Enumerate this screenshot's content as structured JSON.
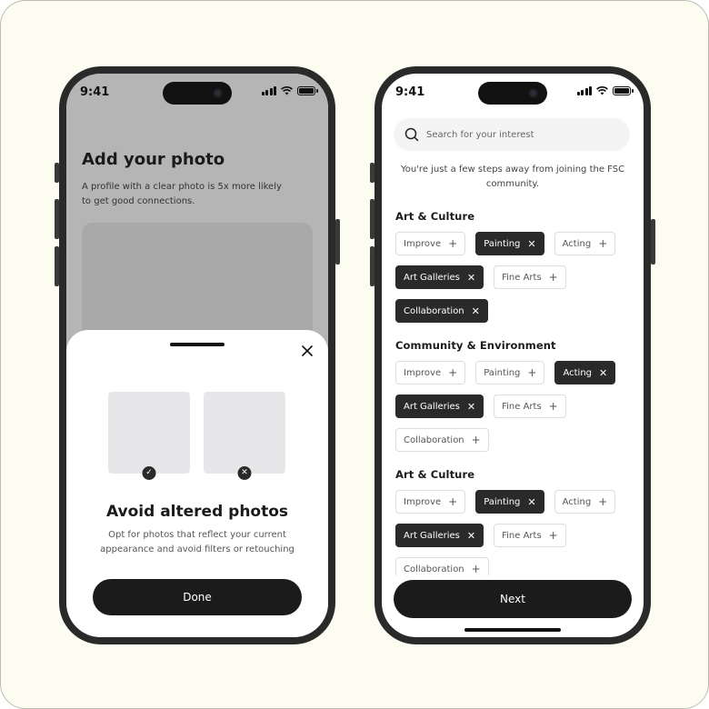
{
  "left_phone": {
    "status_time": "9:41",
    "title": "Add your photo",
    "subtitle": "A profile with a clear photo is 5x more likely to get good connections.",
    "sheet": {
      "close_icon": "close-icon",
      "good_badge_icon": "check-icon",
      "bad_badge_icon": "x-icon",
      "title": "Avoid altered photos",
      "description": "Opt for photos that reflect your current appearance and avoid filters or retouching",
      "done_label": "Done"
    }
  },
  "right_phone": {
    "status_time": "9:41",
    "search": {
      "placeholder": "Search for your interest",
      "value": ""
    },
    "intro": "You're just a few steps away from joining the FSC community.",
    "sections": [
      {
        "title": "Art & Culture",
        "chips": [
          {
            "label": "Improve",
            "selected": false
          },
          {
            "label": "Painting",
            "selected": true
          },
          {
            "label": "Acting",
            "selected": false
          },
          {
            "label": "Art Galleries",
            "selected": true
          },
          {
            "label": "Fine Arts",
            "selected": false
          },
          {
            "label": "Collaboration",
            "selected": true
          }
        ]
      },
      {
        "title": "Community & Environment",
        "chips": [
          {
            "label": "Improve",
            "selected": false
          },
          {
            "label": "Painting",
            "selected": false
          },
          {
            "label": "Acting",
            "selected": true
          },
          {
            "label": "Art Galleries",
            "selected": true
          },
          {
            "label": "Fine Arts",
            "selected": false
          },
          {
            "label": "Collaboration",
            "selected": false
          }
        ]
      },
      {
        "title": "Art & Culture",
        "chips": [
          {
            "label": "Improve",
            "selected": false
          },
          {
            "label": "Painting",
            "selected": true
          },
          {
            "label": "Acting",
            "selected": false
          },
          {
            "label": "Art Galleries",
            "selected": true
          },
          {
            "label": "Fine Arts",
            "selected": false
          },
          {
            "label": "Collaboration",
            "selected": false
          }
        ]
      }
    ],
    "next_label": "Next"
  },
  "colors": {
    "background": "#fdfcf0",
    "phone_frame": "#2a2a2a",
    "primary_button": "#1b1b1b",
    "chip_selected": "#2a2a2a",
    "chip_border": "#dddddd",
    "overlay": "#b5b5b5"
  }
}
